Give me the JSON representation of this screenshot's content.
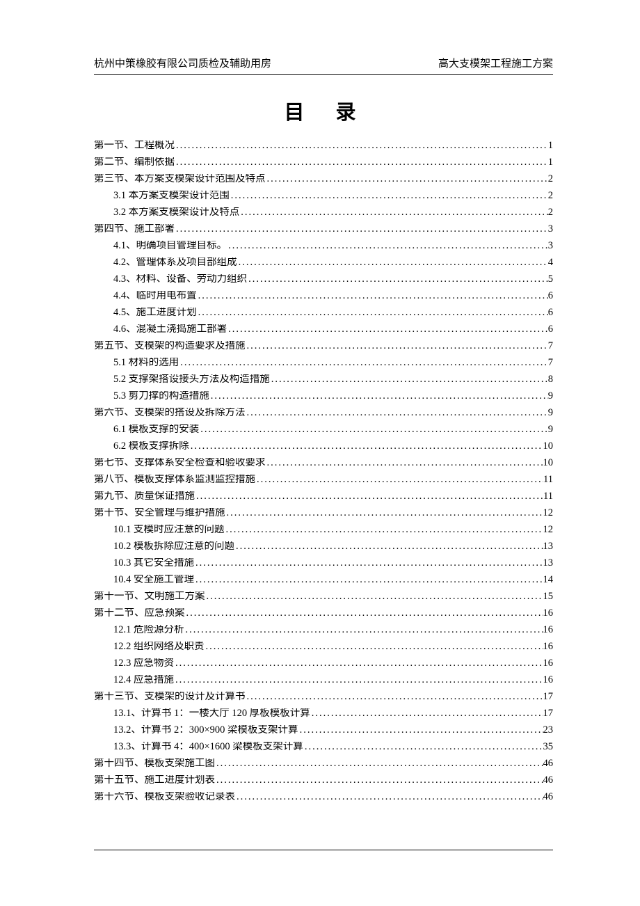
{
  "header": {
    "left": "杭州中策橡胶有限公司质检及辅助用房",
    "right": "高大支模架工程施工方案"
  },
  "title": "目录",
  "toc": [
    {
      "level": 1,
      "label": "第一节、工程概况",
      "page": "1"
    },
    {
      "level": 1,
      "label": "第二节、编制依据",
      "page": "1"
    },
    {
      "level": 1,
      "label": "第三节、本方案支模架设计范围及特点",
      "page": "2"
    },
    {
      "level": 2,
      "label": "3.1 本方案支模架设计范围",
      "page": "2"
    },
    {
      "level": 2,
      "label": "3.2 本方案支模架设计及特点",
      "page": "2"
    },
    {
      "level": 1,
      "label": "第四节、施工部署",
      "page": "3"
    },
    {
      "level": 2,
      "label": "4.1、明确项目管理目标。",
      "page": "3"
    },
    {
      "level": 2,
      "label": "4.2、管理体系及项目部组成",
      "page": "4"
    },
    {
      "level": 2,
      "label": "4.3、材料、设备、劳动力组织",
      "page": "5"
    },
    {
      "level": 2,
      "label": "4.4、临时用电布置",
      "page": "6"
    },
    {
      "level": 2,
      "label": "4.5、施工进度计划",
      "page": "6"
    },
    {
      "level": 2,
      "label": "4.6、混凝土浇捣施工部署",
      "page": "6"
    },
    {
      "level": 1,
      "label": "第五节、支模架的构造要求及措施",
      "page": "7"
    },
    {
      "level": 2,
      "label": "5.1 材料的选用",
      "page": "7"
    },
    {
      "level": 2,
      "label": "5.2 支撑架搭设接头方法及构造措施",
      "page": "8"
    },
    {
      "level": 2,
      "label": "5.3 剪刀撑的构造措施",
      "page": "9"
    },
    {
      "level": 1,
      "label": "第六节、支模架的搭设及拆除方法",
      "page": "9"
    },
    {
      "level": 2,
      "label": "6.1 模板支撑的安装",
      "page": "9"
    },
    {
      "level": 2,
      "label": "6.2 模板支撑拆除",
      "page": "10"
    },
    {
      "level": 1,
      "label": "第七节、支撑体系安全检查和验收要求",
      "page": "10"
    },
    {
      "level": 1,
      "label": "第八节、模板支撑体系监测监控措施",
      "page": "11"
    },
    {
      "level": 1,
      "label": "第九节、质量保证措施",
      "page": "11"
    },
    {
      "level": 1,
      "label": "第十节、安全管理与维护措施",
      "page": "12"
    },
    {
      "level": 2,
      "label": "10.1 支模时应注意的问题",
      "page": "12"
    },
    {
      "level": 2,
      "label": "10.2 模板拆除应注意的问题",
      "page": "13"
    },
    {
      "level": 2,
      "label": "10.3 其它安全措施",
      "page": "13"
    },
    {
      "level": 2,
      "label": "10.4 安全施工管理",
      "page": "14"
    },
    {
      "level": 1,
      "label": "第十一节、文明施工方案",
      "page": "15"
    },
    {
      "level": 1,
      "label": "第十二节、应急预案",
      "page": "16"
    },
    {
      "level": 2,
      "label": "12.1 危险源分析",
      "page": "16"
    },
    {
      "level": 2,
      "label": "12.2 组织网络及职责",
      "page": "16"
    },
    {
      "level": 2,
      "label": "12.3 应急物资",
      "page": "16"
    },
    {
      "level": 2,
      "label": "12.4 应急措施",
      "page": "16"
    },
    {
      "level": 1,
      "label": "第十三节、支模架的设计及计算书",
      "page": "17"
    },
    {
      "level": 2,
      "label": "13.1、计算书 1：一楼大厅 120 厚板模板计算",
      "page": "17"
    },
    {
      "level": 2,
      "label": "13.2、计算书 2：300×900 梁模板支架计算",
      "page": "23"
    },
    {
      "level": 2,
      "label": "13.3、计算书 4：400×1600 梁模板支架计算",
      "page": "35"
    },
    {
      "level": 1,
      "label": "第十四节、模板支架施工图",
      "page": "46"
    },
    {
      "level": 1,
      "label": "第十五节、施工进度计划表",
      "page": "46"
    },
    {
      "level": 1,
      "label": "第十六节、模板支架验收记录表",
      "page": "46"
    }
  ]
}
